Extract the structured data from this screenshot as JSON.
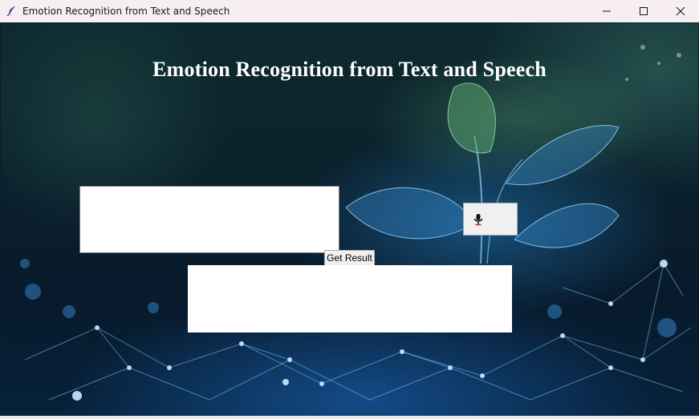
{
  "window": {
    "title": "Emotion Recognition from Text and Speech",
    "controls": {
      "minimize_icon": "minimize-icon",
      "maximize_icon": "maximize-icon",
      "close_icon": "close-icon"
    }
  },
  "main": {
    "heading": "Emotion Recognition from Text and Speech",
    "text_input": {
      "value": "",
      "placeholder": ""
    },
    "mic_button": {
      "icon": "microphone-icon"
    },
    "result_button_label": "Get Result",
    "result_text": ""
  },
  "colors": {
    "titlebar": "#f7eef3",
    "heading_text": "#ffffff",
    "button_face": "#f0f0f0"
  }
}
